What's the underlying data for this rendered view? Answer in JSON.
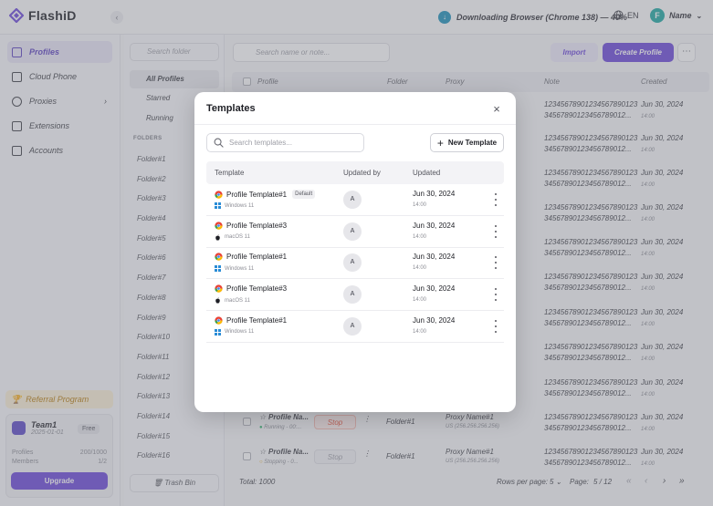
{
  "app": {
    "logo_text": "FlashiD",
    "download_status": "Downloading Browser (Chrome 138) — 40%",
    "download_progress": 0.4,
    "language": "EN",
    "user_initial": "F",
    "user_name": "Name"
  },
  "sidebar": {
    "items": [
      {
        "label": "Profiles",
        "icon": "profiles-icon",
        "active": true
      },
      {
        "label": "Cloud Phone",
        "icon": "phone-icon"
      },
      {
        "label": "Proxies",
        "icon": "proxy-icon"
      },
      {
        "label": "Extensions",
        "icon": "extensions-icon"
      },
      {
        "label": "Accounts",
        "icon": "accounts-icon"
      }
    ],
    "referral": "Referral Program",
    "team": {
      "name": "Team1",
      "date": "2025-01-01",
      "plan": "Free",
      "profiles_label": "Profiles",
      "profiles_value": "200/1000",
      "members_label": "Members",
      "members_value": "1/2",
      "upgrade": "Upgrade"
    }
  },
  "folders": {
    "search_placeholder": "Search folder",
    "nav": [
      "All Profiles",
      "Starred",
      "Running"
    ],
    "heading": "FOLDERS",
    "items": [
      "Folder#1",
      "Folder#2",
      "Folder#3",
      "Folder#4",
      "Folder#5",
      "Folder#6",
      "Folder#7",
      "Folder#8",
      "Folder#9",
      "Folder#10",
      "Folder#11",
      "Folder#12",
      "Folder#13",
      "Folder#14",
      "Folder#15",
      "Folder#16"
    ],
    "trash": "Trash Bin"
  },
  "main": {
    "search_placeholder": "Search name or note...",
    "import": "Import",
    "create": "Create Profile",
    "columns": {
      "profile": "Profile",
      "folder": "Folder",
      "proxy": "Proxy",
      "note": "Note",
      "created": "Created"
    },
    "note_line1": "12345678901234567890123",
    "note_line2": "345678901234567890​12...",
    "created_date": "Jun 30, 2024",
    "created_time": "14:00",
    "visible_rows": [
      {
        "profile": "Profile Na...",
        "status": "Running - 00:...",
        "action": "Stop",
        "folder": "Folder#1",
        "proxy": "Proxy Name#1",
        "proxy_ip": "US (256.256.256.256)"
      },
      {
        "profile": "Profile Na...",
        "status": "Stopping - 0...",
        "action": "Stop",
        "folder": "Folder#1",
        "proxy": "Proxy Name#1",
        "proxy_ip": "US (256.256.256.256)"
      }
    ],
    "footer": {
      "total": "Total: 1000",
      "rows_per_page": "Rows per page:",
      "rows_value": "5",
      "page_label": "Page:",
      "page_value": "5 / 12"
    }
  },
  "modal": {
    "title": "Templates",
    "search_placeholder": "Search templates...",
    "new_template": "New Template",
    "columns": {
      "template": "Template",
      "updated_by": "Updated by",
      "updated": "Updated"
    },
    "rows": [
      {
        "name": "Profile Template#1",
        "badge": "Default",
        "os": "Windows 11",
        "os_icon": "windows-icon",
        "updated_by": "A",
        "date": "Jun 30, 2024",
        "time": "14:00"
      },
      {
        "name": "Profile Template#3",
        "badge": "",
        "os": "macOS 11",
        "os_icon": "apple-icon",
        "updated_by": "A",
        "date": "Jun 30, 2024",
        "time": "14:00"
      },
      {
        "name": "Profile Template#1",
        "badge": "",
        "os": "Windows 11",
        "os_icon": "windows-icon",
        "updated_by": "A",
        "date": "Jun 30, 2024",
        "time": "14:00"
      },
      {
        "name": "Profile Template#3",
        "badge": "",
        "os": "macOS 11",
        "os_icon": "apple-icon",
        "updated_by": "A",
        "date": "Jun 30, 2024",
        "time": "14:00"
      },
      {
        "name": "Profile Template#1",
        "badge": "",
        "os": "Windows 11",
        "os_icon": "windows-icon",
        "updated_by": "A",
        "date": "Jun 30, 2024",
        "time": "14:00"
      }
    ]
  },
  "colors": {
    "accent": "#6A45D9",
    "overlay": "#787A84",
    "referral_bg": "#FBF0D6",
    "running": "#2DB36A",
    "stopping": "#E6A817",
    "stop_button": "#E8503A"
  }
}
